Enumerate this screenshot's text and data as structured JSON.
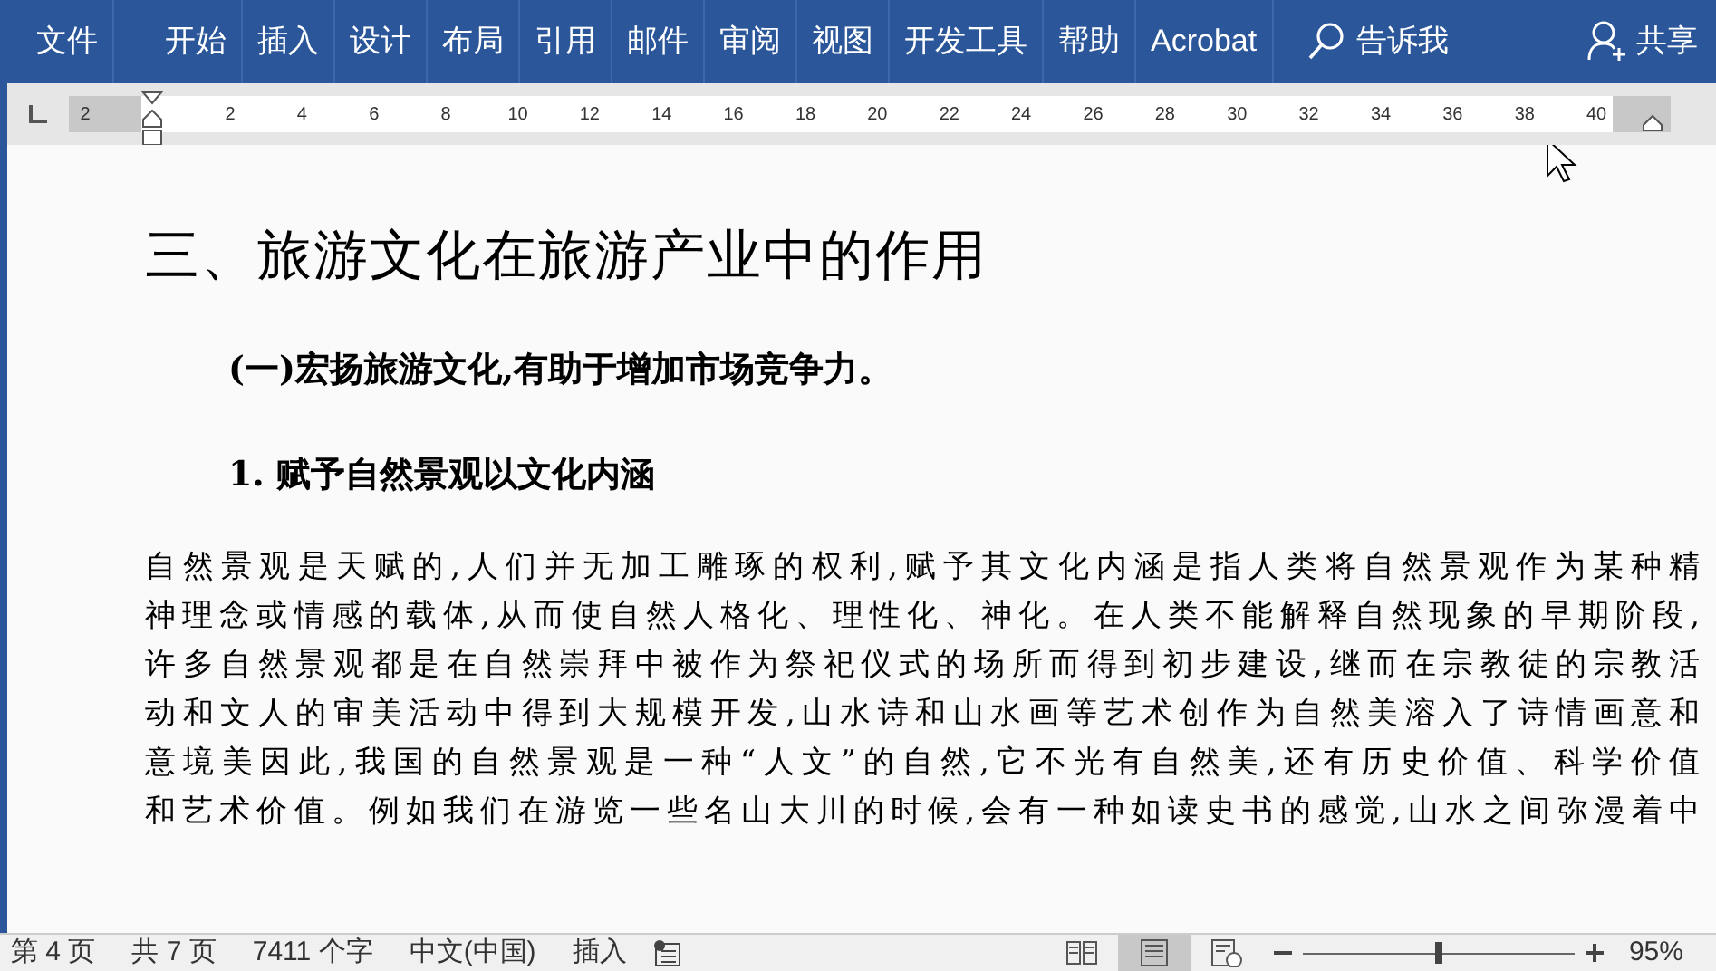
{
  "ribbon_tabs": [
    {
      "label": "文件",
      "selected": false
    },
    {
      "label": "开始",
      "selected": false
    },
    {
      "label": "插入",
      "selected": false
    },
    {
      "label": "设计",
      "selected": false
    },
    {
      "label": "布局",
      "selected": false
    },
    {
      "label": "引用",
      "selected": false
    },
    {
      "label": "邮件",
      "selected": false
    },
    {
      "label": "审阅",
      "selected": false
    },
    {
      "label": "视图",
      "selected": false
    },
    {
      "label": "开发工具",
      "selected": false
    },
    {
      "label": "帮助",
      "selected": false
    },
    {
      "label": "Acrobat",
      "selected": false
    }
  ],
  "tell_me": "告诉我",
  "share": "共享",
  "ruler": {
    "labels": [
      "2",
      "2",
      "4",
      "6",
      "8",
      "10",
      "12",
      "14",
      "16",
      "18",
      "20",
      "22",
      "24",
      "26",
      "28",
      "30",
      "32",
      "34",
      "36",
      "38",
      "40"
    ]
  },
  "document": {
    "heading": "三、旅游文化在旅游产业中的作用",
    "subheading": "(一)宏扬旅游文化,有助于增加市场竞争力。",
    "subsubheading": "1. 赋予自然景观以文化内涵",
    "body_lines": [
      "自然景观是天赋的,人们并无加工雕琢的权利,赋予其文化内涵是指人类将自然景观作为某种精",
      "神理念或情感的载体,从而使自然人格化、理性化、神化。在人类不能解释自然现象的早期阶段,",
      "许多自然景观都是在自然崇拜中被作为祭祀仪式的场所而得到初步建设,继而在宗教徒的宗教活",
      "动和文人的审美活动中得到大规模开发,山水诗和山水画等艺术创作为自然美溶入了诗情画意和",
      "意境美因此,我国的自然景观是一种“人文”的自然,它不光有自然美,还有历史价值、科学价值",
      "和艺术价值。例如我们在游览一些名山大川的时候,会有一种如读史书的感觉,山水之间弥漫着中"
    ]
  },
  "status_bar": {
    "items": [
      "第 4 页",
      "共 7 页",
      "7411 个字",
      "中文(中国)",
      "插入"
    ],
    "views": [
      {
        "kind": "read",
        "selected": false
      },
      {
        "kind": "print",
        "selected": true
      },
      {
        "kind": "web",
        "selected": false
      }
    ],
    "zoom": {
      "level": 0.5,
      "label": "95%"
    }
  }
}
